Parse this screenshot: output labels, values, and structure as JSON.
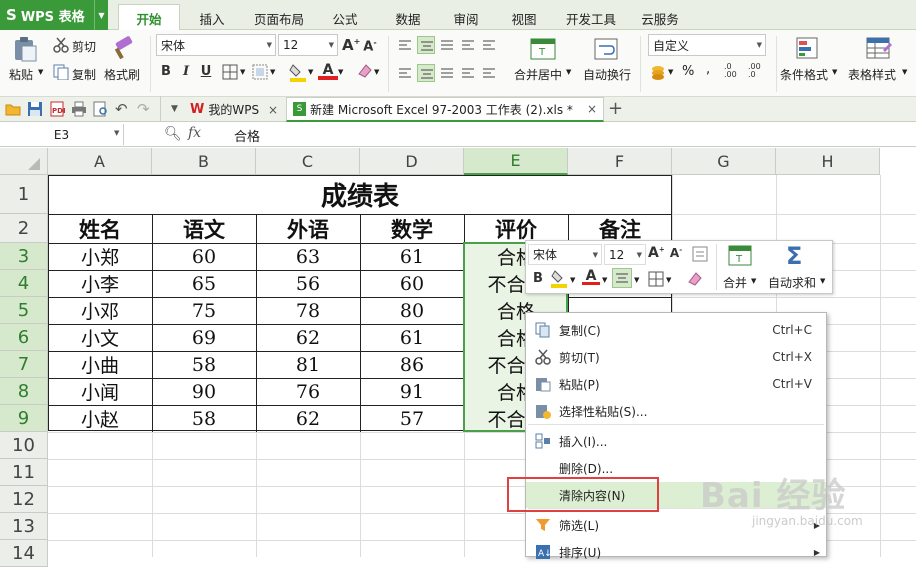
{
  "app": {
    "name": "WPS 表格",
    "logo": "S"
  },
  "menu_tabs": [
    "开始",
    "插入",
    "页面布局",
    "公式",
    "数据",
    "审阅",
    "视图",
    "开发工具",
    "云服务"
  ],
  "ribbon": {
    "paste": "粘贴",
    "cut": "剪切",
    "copy": "复制",
    "format_painter": "格式刷",
    "font_name": "宋体",
    "font_size": "12",
    "bold": "B",
    "italic": "I",
    "underline": "U",
    "merge_center": "合并居中",
    "wrap_text": "自动换行",
    "number_format": "自定义",
    "percent": "%",
    "cond_format": "条件格式",
    "table_style": "表格样式",
    "font_color": "#e02020",
    "fill_color": "#f5d300"
  },
  "doc_tabs": {
    "wps_home": "我的WPS",
    "file": "新建 Microsoft Excel 97-2003 工作表 (2).xls *"
  },
  "formula_bar": {
    "name_box": "E3",
    "fx": "fx",
    "content": "合格"
  },
  "columns": [
    "A",
    "B",
    "C",
    "D",
    "E",
    "F",
    "G",
    "H"
  ],
  "rows": [
    "1",
    "2",
    "3",
    "4",
    "5",
    "6",
    "7",
    "8",
    "9",
    "10",
    "11",
    "12",
    "13",
    "14"
  ],
  "sheet": {
    "title": "成绩表",
    "headers": [
      "姓名",
      "语文",
      "外语",
      "数学",
      "评价",
      "备注"
    ],
    "records": [
      [
        "小郑",
        "60",
        "63",
        "61",
        "合格"
      ],
      [
        "小李",
        "65",
        "56",
        "60",
        "不合格"
      ],
      [
        "小邓",
        "75",
        "78",
        "80",
        "合格"
      ],
      [
        "小文",
        "69",
        "62",
        "61",
        "合格"
      ],
      [
        "小曲",
        "58",
        "81",
        "86",
        "不合格"
      ],
      [
        "小闻",
        "90",
        "76",
        "91",
        "合格"
      ],
      [
        "小赵",
        "58",
        "62",
        "57",
        "不合格"
      ]
    ]
  },
  "mini_toolbar": {
    "font_name": "宋体",
    "font_size": "12",
    "bold": "B",
    "merge": "合并",
    "autosum": "自动求和"
  },
  "context_menu": [
    {
      "label": "复制(C)",
      "shortcut": "Ctrl+C",
      "icon": "copy-icon"
    },
    {
      "label": "剪切(T)",
      "shortcut": "Ctrl+X",
      "icon": "scissors-icon"
    },
    {
      "label": "粘贴(P)",
      "shortcut": "Ctrl+V",
      "icon": "paste-icon"
    },
    {
      "label": "选择性粘贴(S)...",
      "shortcut": "",
      "icon": "paste-special-icon"
    },
    {
      "label": "插入(I)...",
      "shortcut": "",
      "icon": "insert-icon"
    },
    {
      "label": "删除(D)...",
      "shortcut": "",
      "icon": ""
    },
    {
      "label": "清除内容(N)",
      "shortcut": "",
      "icon": ""
    },
    {
      "label": "筛选(L)",
      "shortcut": "",
      "icon": "filter-icon"
    },
    {
      "label": "排序(U)",
      "shortcut": "",
      "icon": "sort-icon"
    }
  ],
  "watermark": {
    "brand": "Bai 经验",
    "url": "jingyan.baidu.com"
  }
}
